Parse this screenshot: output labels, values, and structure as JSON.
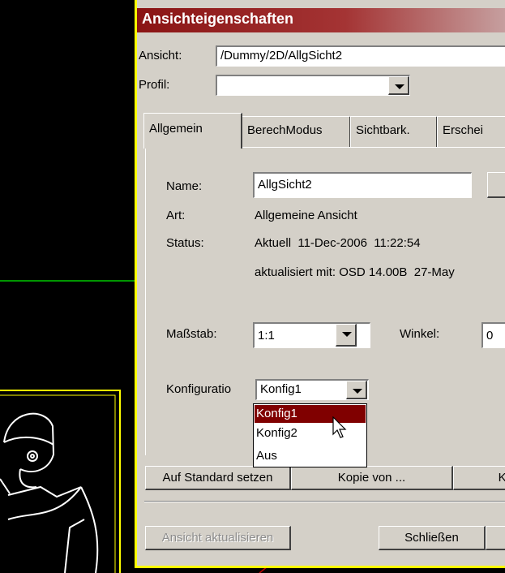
{
  "window": {
    "title": "Ansichteigenschaften"
  },
  "header": {
    "ansicht_label": "Ansicht:",
    "ansicht_value": "/Dummy/2D/AllgSicht2",
    "profil_label": "Profil:",
    "profil_value": ""
  },
  "tabs": [
    {
      "label": "Allgemein",
      "active": true
    },
    {
      "label": "BerechModus",
      "active": false
    },
    {
      "label": "Sichtbark.",
      "active": false
    },
    {
      "label": "Erschei",
      "active": false
    }
  ],
  "general": {
    "name_label": "Name:",
    "name_value": "AllgSicht2",
    "art_label": "Art:",
    "art_value": "Allgemeine Ansicht",
    "status_label": "Status:",
    "status_value": "Aktuell  11-Dec-2006  11:22:54",
    "updated_value": "aktualisiert mit: OSD 14.00B  27-May",
    "scale_label": "Maßstab:",
    "scale_value": "1:1",
    "angle_label": "Winkel:",
    "angle_value": "0",
    "config_label": "Konfiguratio",
    "config_value": "Konfig1",
    "config_options": [
      "Konfig1",
      "Konfig2",
      "Aus"
    ],
    "config_selected_index": 0
  },
  "buttons": {
    "standard": "Auf Standard setzen",
    "copy": "Kopie von ...",
    "ko": "Ko",
    "refresh": "Ansicht aktualisieren",
    "close": "Schließen"
  },
  "colors": {
    "titlebar": "#8a1414",
    "selection": "#800000",
    "highlight_border": "#ffff00",
    "cad_green": "#00c800"
  }
}
